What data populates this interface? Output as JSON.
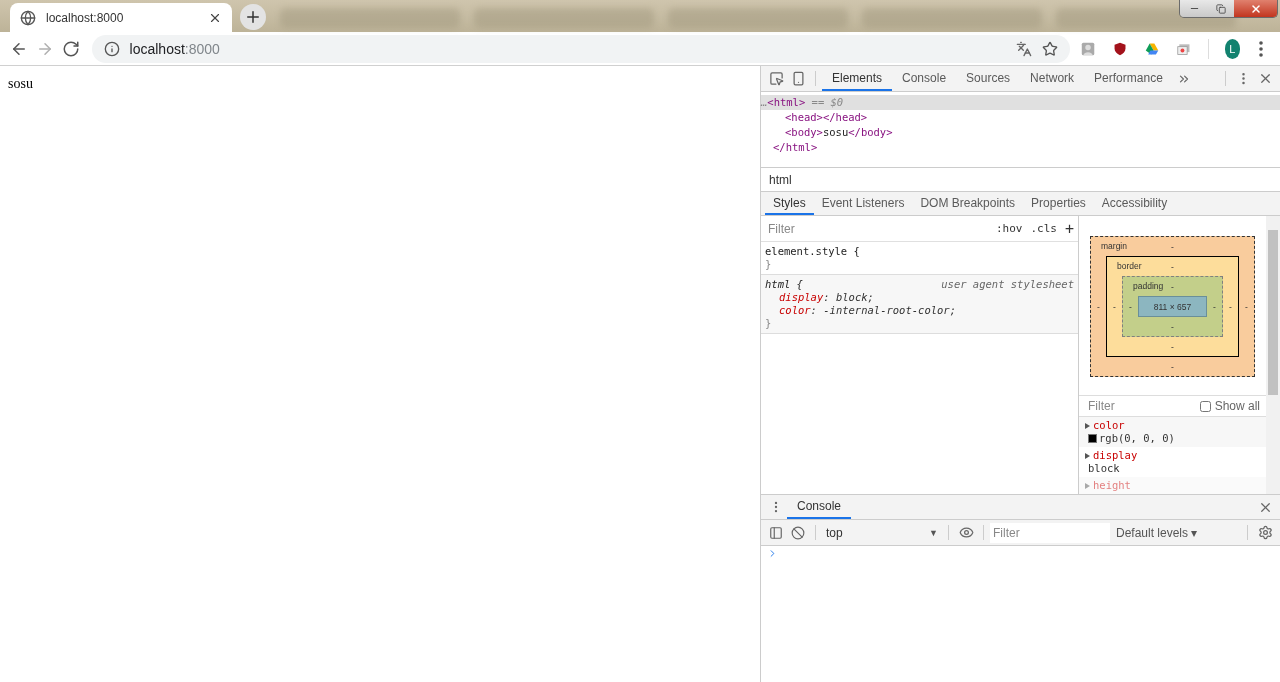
{
  "browser": {
    "active_tab": {
      "title": "localhost:8000"
    },
    "nav": [
      {
        "kind": "back",
        "disabled": false
      },
      {
        "kind": "forward",
        "disabled": true
      },
      {
        "kind": "reload",
        "disabled": false
      }
    ],
    "address": {
      "host": "localhost",
      "port": ":8000"
    },
    "avatar": {
      "initial": "L"
    }
  },
  "page": {
    "body_text": "sosu"
  },
  "devtools": {
    "tabs": [
      {
        "label": "Elements",
        "selected": true
      },
      {
        "label": "Console",
        "selected": false
      },
      {
        "label": "Sources",
        "selected": false
      },
      {
        "label": "Network",
        "selected": false
      },
      {
        "label": "Performance",
        "selected": false
      }
    ],
    "dom_tree": {
      "selected": true,
      "prefix": "…",
      "parts": [
        {
          "kind": "tag",
          "text": "<html>"
        },
        {
          "kind": "meta",
          "text": " == $0"
        }
      ],
      "children": [
        {
          "parts": [
            {
              "kind": "tag",
              "text": "<head></head>"
            }
          ]
        },
        {
          "parts": [
            {
              "kind": "tag",
              "text": "<body>"
            },
            {
              "kind": "text",
              "text": "sosu"
            },
            {
              "kind": "tag",
              "text": "</body>"
            }
          ]
        }
      ],
      "close": [
        {
          "kind": "tag",
          "text": "</html>"
        }
      ]
    },
    "breadcrumb": "html",
    "sub_tabs": [
      {
        "label": "Styles",
        "selected": true
      },
      {
        "label": "Event Listeners",
        "selected": false
      },
      {
        "label": "DOM Breakpoints",
        "selected": false
      },
      {
        "label": "Properties",
        "selected": false
      },
      {
        "label": "Accessibility",
        "selected": false
      }
    ],
    "styles": {
      "filter_placeholder": "Filter",
      "hov": ":hov",
      "cls": ".cls",
      "add": "+",
      "rules": [
        {
          "selector": "element.style {",
          "italic": false,
          "close": "}"
        },
        {
          "selector": "html {",
          "italic": true,
          "source": "user agent stylesheet",
          "declarations": [
            {
              "property": "display",
              "separator": ":",
              "value": "block;"
            },
            {
              "property": "color",
              "separator": ":",
              "value": "-internal-root-color;"
            }
          ],
          "close": "}"
        }
      ]
    },
    "box_model": {
      "margin": {
        "label": "margin",
        "top": "-",
        "right": "-",
        "bottom": "-",
        "left": "-"
      },
      "border": {
        "label": "border",
        "top": "-",
        "right": "-",
        "bottom": "-",
        "left": "-"
      },
      "padding": {
        "label": "padding",
        "top": "-",
        "right": "-",
        "bottom": "-",
        "left": "-"
      },
      "content": "811 × 657"
    },
    "computed": {
      "filter_placeholder": "Filter",
      "show_all": {
        "label": "Show all",
        "checked": false
      },
      "properties": [
        {
          "name": "color",
          "value": "rgb(0, 0, 0)",
          "swatch": true,
          "faded": false
        },
        {
          "name": "display",
          "value": "block",
          "faded": false
        },
        {
          "name": "height",
          "faded": true
        }
      ]
    },
    "drawer": {
      "tabs": [
        {
          "label": "Console",
          "selected": true
        }
      ],
      "context": "top",
      "context_caret": "▼",
      "filter_placeholder": "Filter",
      "levels": "Default levels ▾"
    }
  }
}
